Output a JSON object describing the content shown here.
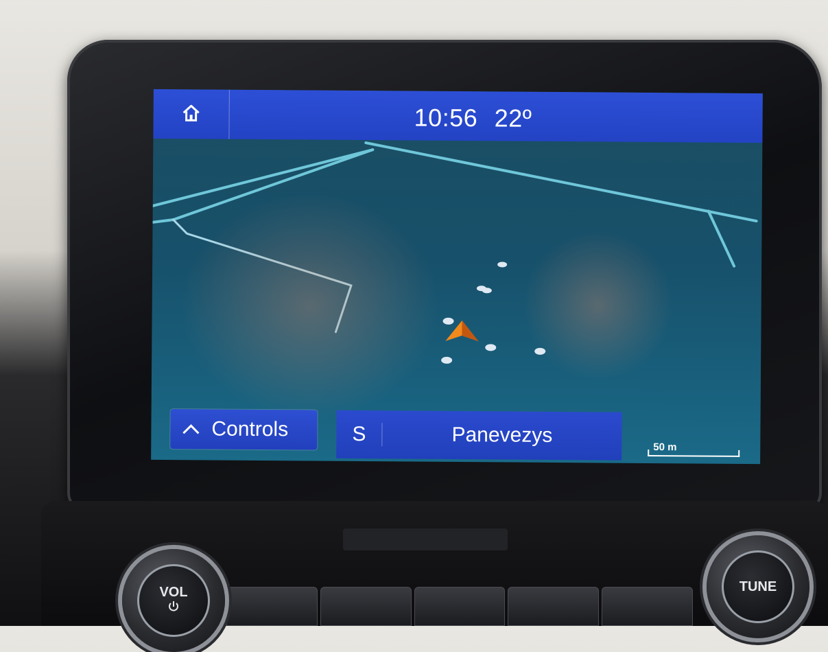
{
  "header": {
    "time": "10:56",
    "temperature": "22º"
  },
  "map": {
    "controls_label": "Controls",
    "heading": "S",
    "street_name": "Panevezys",
    "scale_label": "50 m",
    "road_color": "#6fc7d9",
    "arrow_color": "#f08a1c"
  },
  "hardware": {
    "vol_label": "VOL",
    "tune_label": "TUNE"
  },
  "icons": {
    "home": "home-icon",
    "chevron": "chevron-up-icon",
    "power": "power-icon"
  }
}
